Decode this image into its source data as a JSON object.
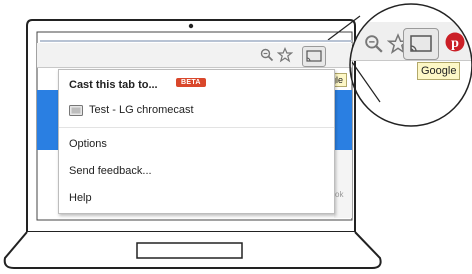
{
  "toolbar": {
    "tooltip": "Google"
  },
  "cast_menu": {
    "title": "Cast this tab to...",
    "badge": "BETA",
    "device": "Test - LG chromecast",
    "items": [
      "Options",
      "Send feedback...",
      "Help"
    ]
  },
  "page": {
    "side_text": "ok"
  },
  "magnifier": {
    "tooltip": "Google"
  },
  "colors": {
    "beta_badge": "#d9472b",
    "page_blue": "#2a7fe2",
    "tooltip_bg": "#fdf7c6",
    "pinterest": "#cb2027"
  }
}
